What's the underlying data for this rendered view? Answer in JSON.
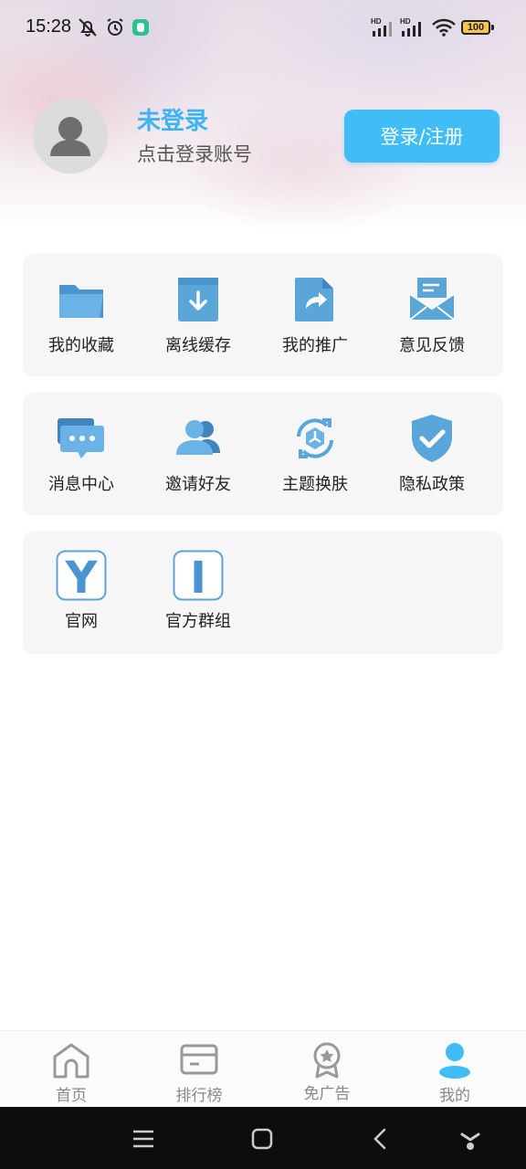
{
  "status_bar": {
    "time": "15:28",
    "battery": "100",
    "icons": [
      "mute-icon",
      "alarm-icon",
      "app-notification-icon",
      "signal-hd-icon",
      "signal-hd-icon",
      "wifi-icon",
      "battery-icon"
    ]
  },
  "profile": {
    "title": "未登录",
    "subtitle": "点击登录账号",
    "login_button": "登录/注册"
  },
  "menu_groups": [
    {
      "items": [
        {
          "label": "我的收藏",
          "icon": "folder-icon"
        },
        {
          "label": "离线缓存",
          "icon": "download-box-icon"
        },
        {
          "label": "我的推广",
          "icon": "share-icon"
        },
        {
          "label": "意见反馈",
          "icon": "mail-icon"
        }
      ]
    },
    {
      "items": [
        {
          "label": "消息中心",
          "icon": "message-icon"
        },
        {
          "label": "邀请好友",
          "icon": "users-icon"
        },
        {
          "label": "主题换肤",
          "icon": "theme-icon"
        },
        {
          "label": "隐私政策",
          "icon": "shield-check-icon"
        }
      ]
    },
    {
      "items": [
        {
          "label": "官网",
          "icon": "website-icon",
          "glyph": "Y"
        },
        {
          "label": "官方群组",
          "icon": "group-icon",
          "glyph": "I"
        }
      ]
    }
  ],
  "bottom_nav": [
    {
      "label": "首页",
      "icon": "home-icon"
    },
    {
      "label": "排行榜",
      "icon": "card-icon"
    },
    {
      "label": "免广告",
      "icon": "badge-icon"
    },
    {
      "label": "我的",
      "icon": "user-icon",
      "active": true
    }
  ],
  "colors": {
    "accent": "#40bdf7",
    "icon_blue": "#5aa6d8",
    "card_bg": "#f6f6f6"
  }
}
